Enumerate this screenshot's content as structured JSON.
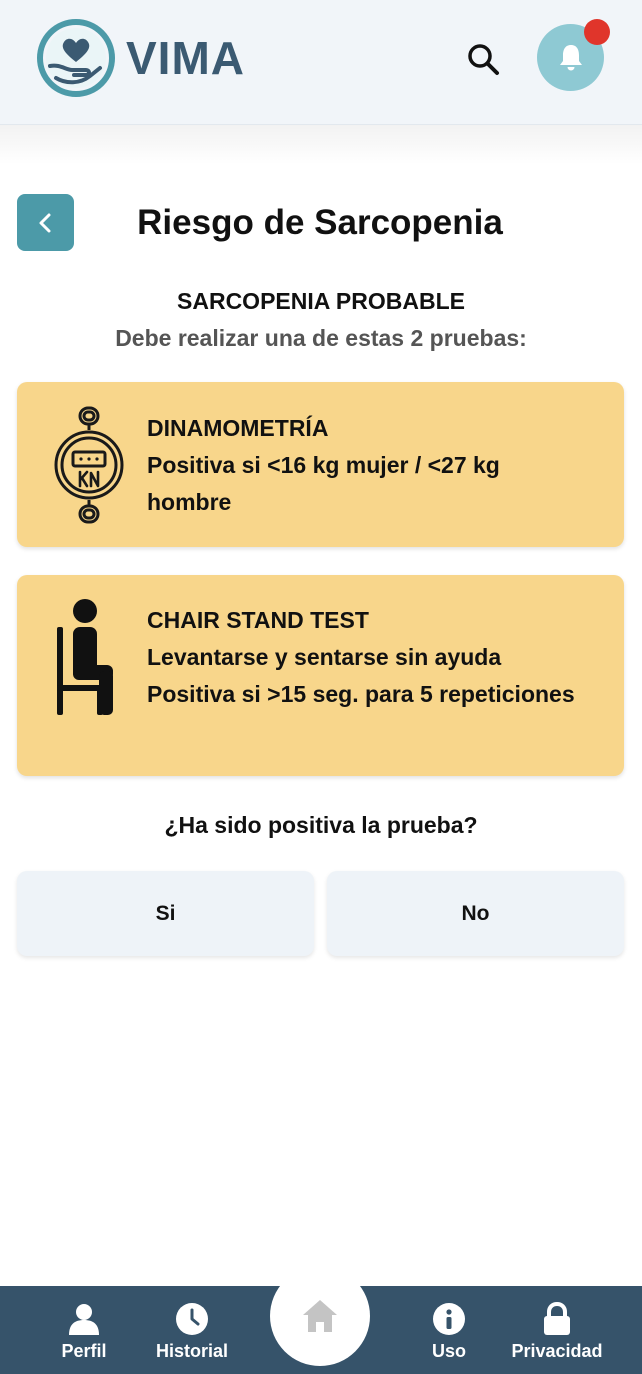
{
  "header": {
    "app_name": "VIMA",
    "logo_icon": "heart-hands-logo",
    "search_icon": "search-icon",
    "notification_icon": "bell-icon",
    "notification_badge_color": "#e0352b"
  },
  "page": {
    "title": "Riesgo de Sarcopenia",
    "back_icon": "chevron-left-icon",
    "status": "SARCOPENIA PROBABLE",
    "instructions": "Debe realizar una de estas 2 pruebas:"
  },
  "tests": [
    {
      "icon": "dynamometer-icon",
      "title": "DINAMOMETRÍA",
      "lines": [
        "Positiva si <16 kg mujer / <27 kg hombre"
      ]
    },
    {
      "icon": "chair-stand-icon",
      "title": "CHAIR STAND TEST",
      "lines": [
        "Levantarse y sentarse sin ayuda",
        "Positiva si >15 seg. para 5 repeticiones"
      ]
    }
  ],
  "question": {
    "text": "¿Ha sido positiva la prueba?",
    "yes_label": "Si",
    "no_label": "No"
  },
  "bottom_nav": {
    "items": [
      {
        "label": "Perfil",
        "icon": "user-icon"
      },
      {
        "label": "Historial",
        "icon": "clock-icon"
      },
      {
        "label": "",
        "icon": "home-icon"
      },
      {
        "label": "Uso",
        "icon": "info-icon"
      },
      {
        "label": "Privacidad",
        "icon": "lock-icon"
      }
    ]
  },
  "colors": {
    "brand": "#3b5a72",
    "accent_teal": "#4c9aa8",
    "card_background": "#f8d68b",
    "nav_background": "#36536a"
  }
}
